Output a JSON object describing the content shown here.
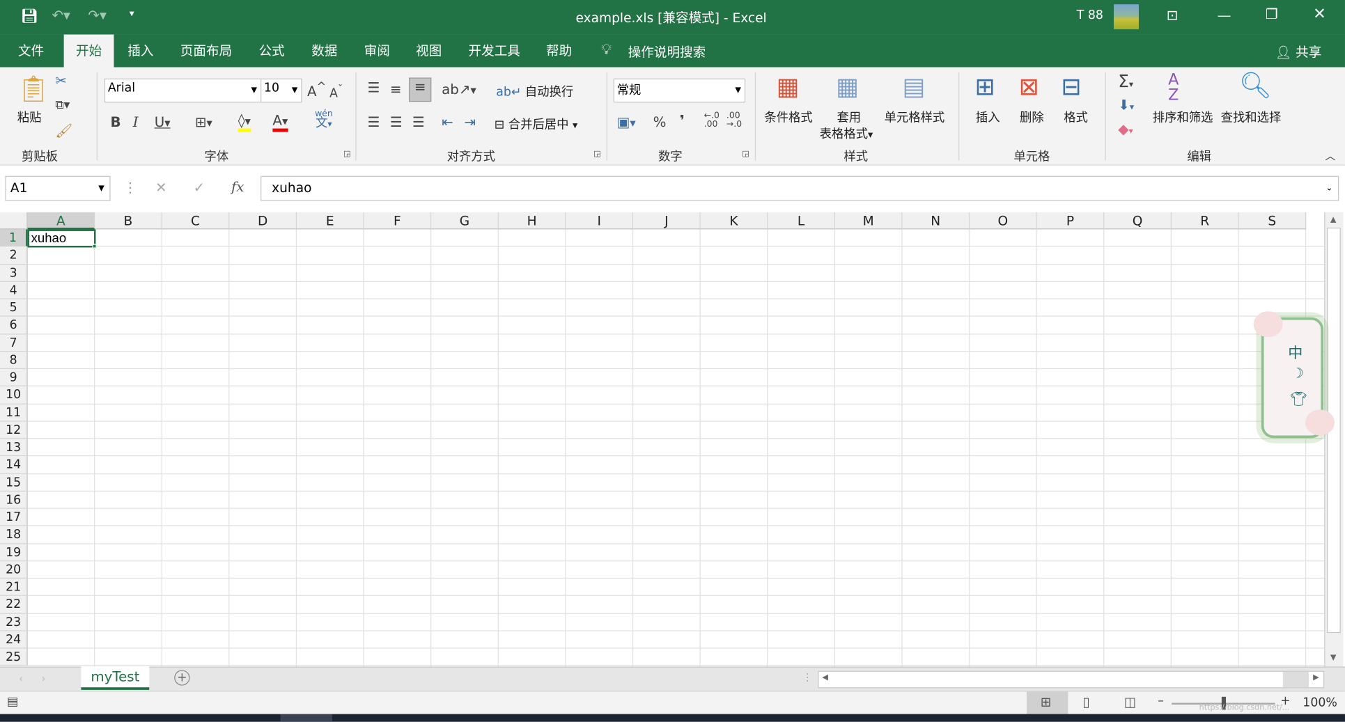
{
  "window": {
    "title": "example.xls  [兼容模式]  -  Excel",
    "user": "T 88",
    "accent": "#217346"
  },
  "tabs": [
    "文件",
    "开始",
    "插入",
    "页面布局",
    "公式",
    "数据",
    "审阅",
    "视图",
    "开发工具",
    "帮助"
  ],
  "active_tab": "开始",
  "search_label": "操作说明搜索",
  "share_label": "共享",
  "ribbon": {
    "clipboard": {
      "paste": "粘贴",
      "group": "剪贴板"
    },
    "font": {
      "name": "Arial",
      "size": "10",
      "group": "字体",
      "phonetic": "wén",
      "phonetic_char": "文"
    },
    "alignment": {
      "wrap": "自动换行",
      "merge": "合并后居中",
      "group": "对齐方式"
    },
    "number": {
      "format": "常规",
      "percent": "%",
      "comma": "❜",
      "group": "数字"
    },
    "styles": {
      "conditional": "条件格式",
      "table1": "套用",
      "table2": "表格格式",
      "cell": "单元格样式",
      "group": "样式"
    },
    "cells": {
      "insert": "插入",
      "delete": "删除",
      "format": "格式",
      "group": "单元格"
    },
    "editing": {
      "sort": "排序和筛选",
      "find": "查找和选择",
      "group": "编辑"
    }
  },
  "formula_bar": {
    "name_box": "A1",
    "formula": "xuhao",
    "fx": "fx"
  },
  "columns": [
    "A",
    "B",
    "C",
    "D",
    "E",
    "F",
    "G",
    "H",
    "I",
    "J",
    "K",
    "L",
    "M",
    "N",
    "O",
    "P",
    "Q",
    "R",
    "S"
  ],
  "rows": [
    "1",
    "2",
    "3",
    "4",
    "5",
    "6",
    "7",
    "8",
    "9",
    "10",
    "11",
    "12",
    "13",
    "14",
    "15",
    "16",
    "17",
    "18",
    "19",
    "20",
    "21",
    "22",
    "23",
    "24",
    "25"
  ],
  "cells": {
    "A1": "xuhao"
  },
  "ime": {
    "lang": "中"
  },
  "sheets": [
    {
      "name": "myTest",
      "active": true
    }
  ],
  "status": {
    "zoom": "100%",
    "zoom_percent": 100,
    "watermark": "https://blog.csdn.net/..."
  }
}
